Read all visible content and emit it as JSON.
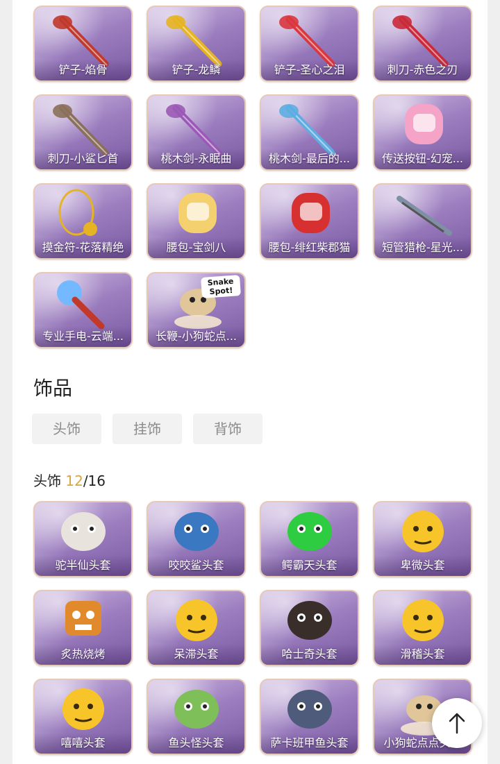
{
  "weapons": [
    {
      "label": "铲子-焰骨",
      "art": "shovel-fire-icon",
      "accent": "#c0392b"
    },
    {
      "label": "铲子-龙鳞",
      "art": "shovel-gold-icon",
      "accent": "#e6b422"
    },
    {
      "label": "铲子-圣心之泪",
      "art": "shovel-heart-icon",
      "accent": "#d9363e"
    },
    {
      "label": "刺刀-赤色之刃",
      "art": "blade-red-icon",
      "accent": "#c92a3a"
    },
    {
      "label": "刺刀-小鲨匕首",
      "art": "dagger-shark-icon",
      "accent": "#8a6f5a"
    },
    {
      "label": "桃木剑-永眠曲",
      "art": "sword-purple-icon",
      "accent": "#9b59b6"
    },
    {
      "label": "桃木剑-最后的...",
      "art": "sword-blue-icon",
      "accent": "#5dade2"
    },
    {
      "label": "传送按钮-幻宠...",
      "art": "device-pet-icon",
      "accent": "#f5a3c7"
    },
    {
      "label": "摸金符-花落精绝",
      "art": "charm-flower-icon",
      "accent": "#e6b422"
    },
    {
      "label": "腰包-宝剑八",
      "art": "bag-heart-icon",
      "accent": "#f4d06f"
    },
    {
      "label": "腰包-绯红柴郡猫",
      "art": "bag-cat-icon",
      "accent": "#d63031"
    },
    {
      "label": "短管猎枪-星光...",
      "art": "shotgun-star-icon",
      "accent": "#7f8fa6"
    },
    {
      "label": "专业手电-云端...",
      "art": "flashlight-cloud-icon",
      "accent": "#74b9ff"
    },
    {
      "label": "长鞭-小狗蛇点...",
      "art": "whip-snake-icon",
      "accent": "#e1c699",
      "badge": "Snake Spot!"
    }
  ],
  "accessories": {
    "title": "饰品",
    "tabs": [
      "头饰",
      "挂饰",
      "背饰"
    ],
    "headwear_label": "头饰",
    "headwear_owned": "12",
    "headwear_total": "/16"
  },
  "headwear": [
    {
      "label": "驼半仙头套",
      "art": "raccoon-mask-icon",
      "accent": "#e8e3dc"
    },
    {
      "label": "咬咬鲨头套",
      "art": "shark-mask-icon",
      "accent": "#3b78c2"
    },
    {
      "label": "鳄霸天头套",
      "art": "croc-mask-icon",
      "accent": "#2ecc40"
    },
    {
      "label": "卑微头套",
      "art": "humble-emoji-icon",
      "accent": "#f7c52a"
    },
    {
      "label": "炙热烧烤",
      "art": "bbq-box-icon",
      "accent": "#e08a2c"
    },
    {
      "label": "呆滞头套",
      "art": "dull-emoji-icon",
      "accent": "#f7c52a"
    },
    {
      "label": "哈士奇头套",
      "art": "husky-mask-icon",
      "accent": "#3a2e2a"
    },
    {
      "label": "滑稽头套",
      "art": "funny-emoji-icon",
      "accent": "#f7c52a"
    },
    {
      "label": "嘻嘻头套",
      "art": "grin-emoji-icon",
      "accent": "#f7c52a"
    },
    {
      "label": "鱼头怪头套",
      "art": "fishhead-mask-icon",
      "accent": "#7fbf5a"
    },
    {
      "label": "萨卡班甲鱼头套",
      "art": "sacabambaspis-icon",
      "accent": "#4f5b7a"
    },
    {
      "label": "小狗蛇点点头套",
      "art": "snake-mask-icon",
      "accent": "#e1c699"
    }
  ],
  "scroll_top_icon": "arrow-up-icon"
}
